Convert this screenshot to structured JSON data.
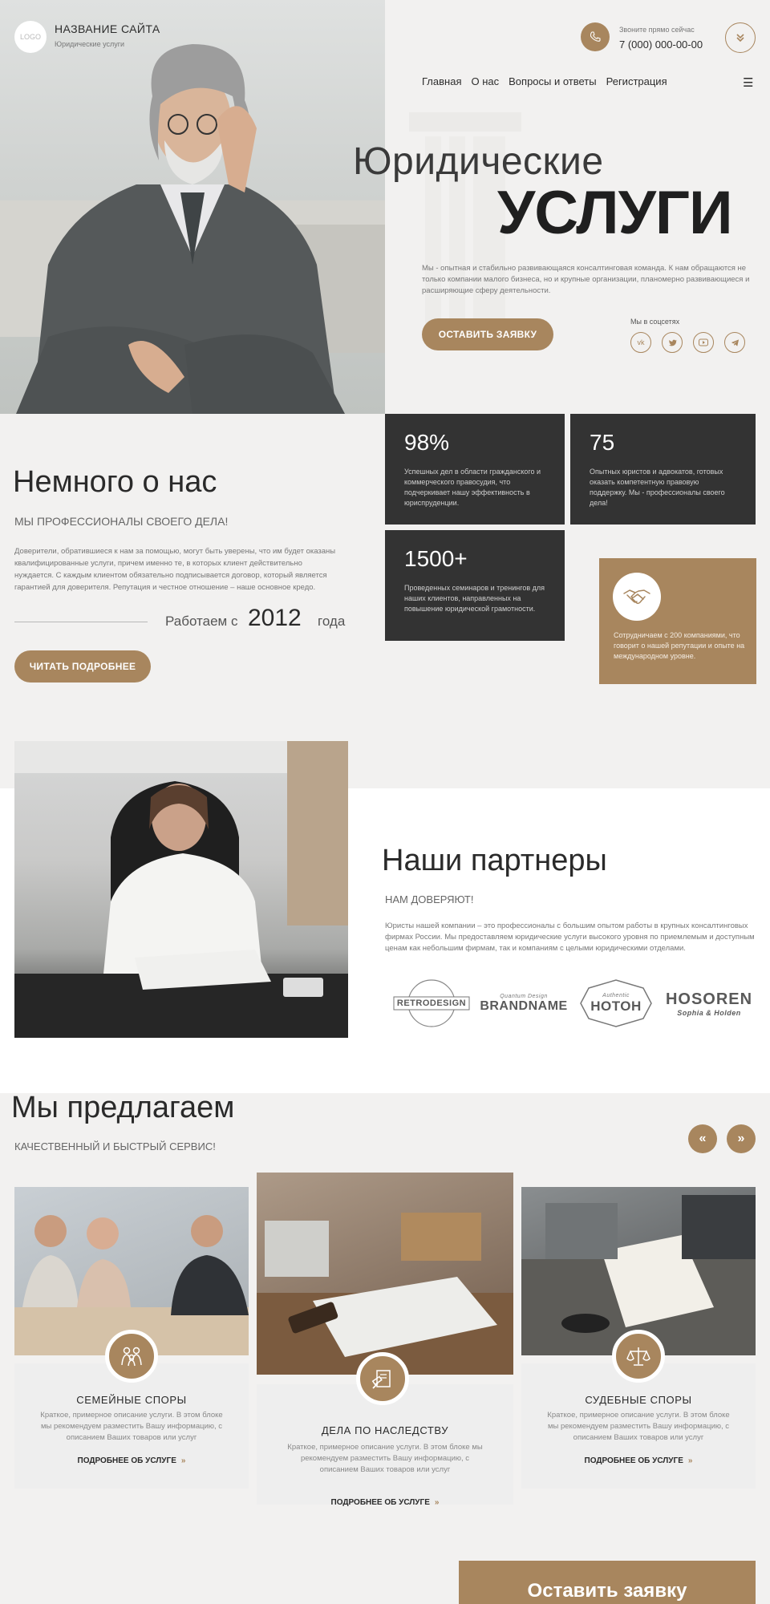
{
  "header": {
    "logo_text": "LOGO",
    "site_name": "НАЗВАНИЕ САЙТА",
    "site_subtitle": "Юридические услуги",
    "phone_caption": "Звоните прямо сейчас",
    "phone_number": "7 (000) 000-00-00",
    "nav": [
      "Главная",
      "О нас",
      "Вопросы и ответы",
      "Регистрация"
    ]
  },
  "hero": {
    "title_line1": "Юридические",
    "title_line2": "УСЛУГИ",
    "description": "Мы - опытная и стабильно развивающаяся консалтинговая команда. К нам обращаются не только компании малого бизнеса, но и крупные организации, планомерно развивающиеся и расширяющие сферу деятельности.",
    "cta": "ОСТАВИТЬ ЗАЯВКУ",
    "social_label": "Мы в соцсетях",
    "socials": [
      "vk-icon",
      "twitter-icon",
      "youtube-icon",
      "telegram-icon"
    ]
  },
  "stats": [
    {
      "number": "98%",
      "text": "Успешных дел в области гражданского и коммерческого правосудия, что подчеркивает нашу эффективность в юриспруденции."
    },
    {
      "number": "75",
      "text": "Опытных юристов и адвокатов, готовых оказать компетентную правовую поддержку. Мы - профессионалы своего дела!"
    },
    {
      "number": "1500+",
      "text": "Проведенных семинаров и тренингов для наших клиентов, направленных на повышение юридической грамотности."
    }
  ],
  "brown_card": {
    "text": "Сотрудничаем с 200 компаниями, что говорит о нашей репутации и опыте на международном уровне."
  },
  "about": {
    "title": "Немного о нас",
    "subtitle": "МЫ ПРОФЕССИОНАЛЫ СВОЕГО ДЕЛА!",
    "description": "Доверители, обратившиеся к нам за помощью, могут быть уверены, что им будет оказаны квалифицированные услуги, причем именно те, в которых клиент действительно нуждается. С каждым клиентом обязательно подписывается договор, который является гарантией для доверителя. Репутация и честное отношение – наше основное кредо.",
    "since_prefix": "Работаем с",
    "since_year": "2012",
    "since_suffix": "года",
    "cta": "ЧИТАТЬ ПОДРОБНЕЕ"
  },
  "partners": {
    "title": "Наши партнеры",
    "subtitle": "НАМ ДОВЕРЯЮТ!",
    "description": "Юристы нашей компании – это профессионалы с большим опытом работы в крупных консалтинговых фирмах России. Мы предоставляем юридические услуги высокого уровня по приемлемым и доступным ценам как небольшим фирмам, так и компаниям с целыми юридическими отделами.",
    "logos": [
      "RETRODESIGN",
      "BRANDNAME",
      "HOTOH",
      "HOSOREN"
    ],
    "logo_subtexts": [
      "",
      "Quantum Design",
      "Authentic",
      "Sophia & Holden"
    ]
  },
  "offer": {
    "title": "Мы предлагаем",
    "subtitle": "КАЧЕСТВЕННЫЙ И БЫСТРЫЙ СЕРВИС!",
    "prev": "«",
    "next": "»",
    "services": [
      {
        "title": "СЕМЕЙНЫЕ СПОРЫ",
        "description": "Краткое, примерное описание услуги. В этом блоке мы рекомендуем разместить Вашу информацию, с описанием Ваших товаров или услуг",
        "more": "ПОДРОБНЕЕ ОБ УСЛУГЕ",
        "icon": "family-icon"
      },
      {
        "title": "ДЕЛА ПО НАСЛЕДСТВУ",
        "description": "Краткое, примерное описание услуги. В этом блоке мы рекомендуем разместить Вашу информацию, с описанием Ваших товаров или услуг",
        "more": "ПОДРОБНЕЕ ОБ УСЛУГЕ",
        "icon": "gavel-document-icon"
      },
      {
        "title": "СУДЕБНЫЕ СПОРЫ",
        "description": "Краткое, примерное описание услуги. В этом блоке мы рекомендуем разместить Вашу информацию, с описанием Ваших товаров или услуг",
        "more": "ПОДРОБНЕЕ ОБ УСЛУГЕ",
        "icon": "scales-icon"
      }
    ],
    "arrow_glyph": "»"
  },
  "bottom_cta": "Оставить заявку",
  "colors": {
    "accent": "#a8865e",
    "dark": "#333333",
    "background": "#f2f1f0"
  }
}
